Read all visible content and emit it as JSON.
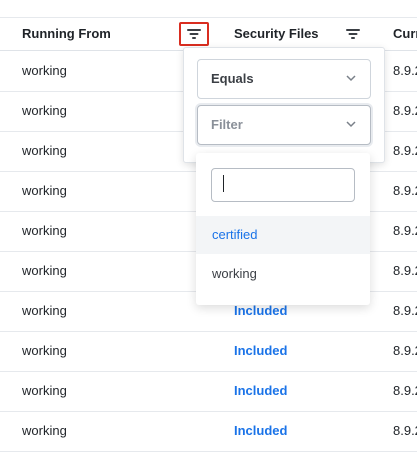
{
  "columns": [
    {
      "label": "Running From"
    },
    {
      "label": "Security Files"
    },
    {
      "label": "Curr"
    }
  ],
  "rows": [
    {
      "running_from": "working",
      "security_files": "",
      "current": "8.9.2"
    },
    {
      "running_from": "working",
      "security_files": "",
      "current": "8.9.2"
    },
    {
      "running_from": "working",
      "security_files": "",
      "current": "8.9.2"
    },
    {
      "running_from": "working",
      "security_files": "",
      "current": "8.9.2"
    },
    {
      "running_from": "working",
      "security_files": "",
      "current": "8.9.2"
    },
    {
      "running_from": "working",
      "security_files": "",
      "current": "8.9.2"
    },
    {
      "running_from": "working",
      "security_files": "Included",
      "current": "8.9.2"
    },
    {
      "running_from": "working",
      "security_files": "Included",
      "current": "8.9.2"
    },
    {
      "running_from": "working",
      "security_files": "Included",
      "current": "8.9.2"
    },
    {
      "running_from": "working",
      "security_files": "Included",
      "current": "8.9.2"
    }
  ],
  "filter_popup": {
    "operator_value": "Equals",
    "filter_placeholder": "Filter",
    "search_value": "",
    "options": [
      "certified",
      "working"
    ],
    "selected_option": "certified"
  },
  "icons": {
    "filter": "filter-icon",
    "chevron": "chevron-down-icon"
  },
  "colors": {
    "accent": "#1a73e8",
    "active_outline": "#d92d20"
  }
}
